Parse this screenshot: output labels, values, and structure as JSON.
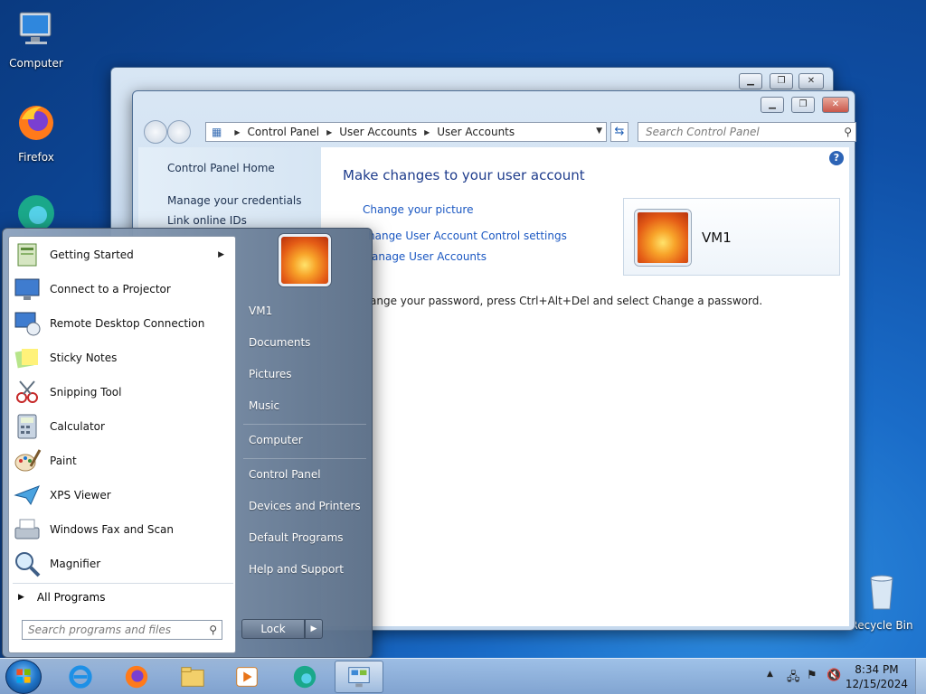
{
  "desktop": {
    "icons": [
      {
        "label": "Computer",
        "icon": "computer-icon"
      },
      {
        "label": "Firefox",
        "icon": "firefox-icon"
      },
      {
        "label": "Recycle Bin",
        "icon": "recycle-bin-icon"
      }
    ]
  },
  "window": {
    "address": [
      "Control Panel",
      "User Accounts",
      "User Accounts"
    ],
    "search_placeholder": "Search Control Panel",
    "left_links": [
      "Control Panel Home",
      "Manage your credentials",
      "Link online IDs"
    ],
    "heading": "Make changes to your user account",
    "tasks": [
      "Change your picture",
      "Change User Account Control settings",
      "Manage User Accounts"
    ],
    "tasks_visible": [
      "Change your picture",
      "hange User Account Control settings",
      "anage User Accounts"
    ],
    "password_note": "ange your password, press Ctrl+Alt+Del and select Change a password.",
    "user_name": "VM1",
    "help": "?"
  },
  "start_menu": {
    "programs": [
      {
        "label": "Getting Started",
        "icon": "getting-started-icon",
        "submenu": true
      },
      {
        "label": "Connect to a Projector",
        "icon": "projector-icon"
      },
      {
        "label": "Remote Desktop Connection",
        "icon": "remote-desktop-icon"
      },
      {
        "label": "Sticky Notes",
        "icon": "sticky-notes-icon"
      },
      {
        "label": "Snipping Tool",
        "icon": "snipping-tool-icon"
      },
      {
        "label": "Calculator",
        "icon": "calculator-icon"
      },
      {
        "label": "Paint",
        "icon": "paint-icon"
      },
      {
        "label": "XPS Viewer",
        "icon": "xps-viewer-icon"
      },
      {
        "label": "Windows Fax and Scan",
        "icon": "fax-scan-icon"
      },
      {
        "label": "Magnifier",
        "icon": "magnifier-icon"
      }
    ],
    "all_programs": "All Programs",
    "search_placeholder": "Search programs and files",
    "right_items": [
      "VM1",
      "Documents",
      "Pictures",
      "Music",
      "Computer",
      "Control Panel",
      "Devices and Printers",
      "Default Programs",
      "Help and Support"
    ],
    "lock_label": "Lock"
  },
  "taskbar": {
    "apps": [
      "internet-explorer-icon",
      "firefox-icon",
      "explorer-icon",
      "media-player-icon",
      "edge-icon",
      "control-panel-icon"
    ],
    "time": "8:34 PM",
    "date": "12/15/2024"
  }
}
